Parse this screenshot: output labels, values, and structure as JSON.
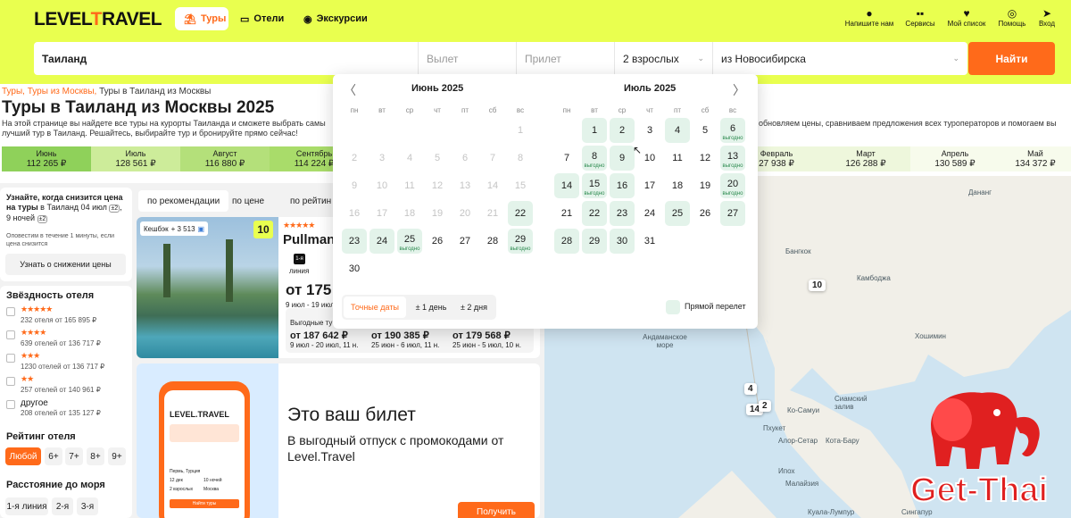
{
  "header": {
    "logo_text": "LEVEL",
    "logo_accent": "T",
    "logo_rest": "RAVEL",
    "nav": [
      {
        "label": "Туры",
        "icon": "palm-icon"
      },
      {
        "label": "Отели",
        "icon": "bed-icon"
      },
      {
        "label": "Экскурсии",
        "icon": "pin-icon"
      }
    ],
    "actions": [
      {
        "label": "Напишите нам",
        "icon": "chat-icon"
      },
      {
        "label": "Сервисы",
        "icon": "grid-icon"
      },
      {
        "label": "Мой список",
        "icon": "heart-icon"
      },
      {
        "label": "Помощь",
        "icon": "lifebuoy-icon"
      },
      {
        "label": "Вход",
        "icon": "login-icon"
      }
    ]
  },
  "search": {
    "destination": "Таиланд",
    "depart_placeholder": "Вылет",
    "arrive_placeholder": "Прилет",
    "guests": "2 взрослых",
    "from_city": "из Новосибирска",
    "submit": "Найти"
  },
  "breadcrumbs": {
    "part1": "Туры,",
    "part2": "Туры из Москвы,",
    "current": "Туры в Таиланд из Москвы"
  },
  "page_title": "Туры в Таиланд из Москвы 2025",
  "description_left": "На этой странице вы найдете все туры на курорты Таиланда и сможете выбрать самы лучший тур в Таиланд. Решайтесь, выбирайте тур и бронируйте прямо сейчас!",
  "description_right": "обновляем цены, сравниваем предложения всех туроператоров и помогаем вы",
  "months": [
    {
      "name": "Июнь",
      "price": "112 265 ₽",
      "color": "#8fd15a"
    },
    {
      "name": "Июль",
      "price": "128 561 ₽",
      "color": "#cdec9a"
    },
    {
      "name": "Август",
      "price": "116 880 ₽",
      "color": "#b4e07a"
    },
    {
      "name": "Сентябрь",
      "price": "114 224 ₽",
      "color": "#a9dc6a"
    },
    {
      "name": "Февраль",
      "price": "27 938 ₽",
      "color": "#eef7dc"
    },
    {
      "name": "Март",
      "price": "126 288 ₽",
      "color": "#eef7dc"
    },
    {
      "name": "Апрель",
      "price": "130 589 ₽",
      "color": "#f7fbec"
    },
    {
      "name": "Май",
      "price": "134 372 ₽",
      "color": "#f7fbec"
    }
  ],
  "sidebar": {
    "notify_title_bold": "Узнайте, когда снизится цена на туры",
    "notify_title_rest": "в Таиланд 04 июл",
    "notify_badge1": "±2",
    "notify_nights": "9 ночей",
    "notify_badge2": "±2",
    "notify_sub": "Оповестим в течение 1 минуты, если цена снизится",
    "notify_button": "Узнать о снижении цены",
    "stars_title": "Звёздность отеля",
    "stars": [
      {
        "stars": "★★★★★",
        "count": "232 отеля от 165 895 ₽"
      },
      {
        "stars": "★★★★",
        "count": "639 отелей от 136 717 ₽"
      },
      {
        "stars": "★★★",
        "count": "1230 отелей от 136 717 ₽"
      },
      {
        "stars": "★★",
        "count": "257 отелей от 140 961 ₽"
      },
      {
        "stars": "другое",
        "count": "208 отелей от 135 127 ₽"
      }
    ],
    "rating_title": "Рейтинг отеля",
    "rating_options": [
      "Любой",
      "6+",
      "7+",
      "8+",
      "9+"
    ],
    "sea_title": "Расстояние до моря",
    "sea_options": [
      "1-я линия",
      "2-я",
      "3-я"
    ]
  },
  "sort_tabs": [
    "по рекомендации",
    "по цене",
    "по рейтин"
  ],
  "hotel_card": {
    "cashback": "Кешбэк",
    "cashback_value": "+ 3 513",
    "rating": "10",
    "stars": "★★★★★",
    "name": "Pullman",
    "line_badge": "1-я",
    "line_label": "линия",
    "price_from": "от 175",
    "dates": "9 июл - 19 июл",
    "best_label": "Выгодные ту",
    "offers": [
      {
        "price": "от 187 642 ₽",
        "dates": "9 июл - 20 июл, 11 н."
      },
      {
        "price": "от 190 385 ₽",
        "dates": "25 июн - 6 июл, 11 н."
      },
      {
        "price": "от 179 568 ₽",
        "dates": "25 июн - 5 июл, 10 н."
      }
    ]
  },
  "promo": {
    "title": "Это ваш билет",
    "subtitle": "В выгодный отпуск с промокодами от Level.Travel",
    "button": "Получить",
    "phone_logo": "LEVEL.TRAVEL",
    "phone_city": "Пермь, Турция",
    "phone_date": "12 дек",
    "phone_nights": "10 ночей",
    "phone_guests": "2 взрослых",
    "phone_from": "Москва",
    "phone_button": "Найти туры"
  },
  "calendar": {
    "month_left": "Июнь 2025",
    "month_right": "Июль 2025",
    "dow": [
      "пн",
      "вт",
      "ср",
      "чт",
      "пт",
      "сб",
      "вс"
    ],
    "badge_text": "выгодно",
    "modes": [
      "Точные даты",
      "± 1 день",
      "± 2 дня"
    ],
    "direct_label": "Прямой перелет"
  },
  "map": {
    "labels": [
      "Дананг",
      "Бангкок",
      "Камбоджа",
      "Андаманское море",
      "Хошимин",
      "Сиамский залив",
      "Пхукет",
      "Малайзия",
      "Куала-Лумпур",
      "Сингапур",
      "Ко-Самуи",
      "Алор-Сетар",
      "Ипох",
      "Кота-Бару"
    ],
    "badges": [
      "10",
      "4",
      "14",
      "2"
    ]
  },
  "watermark": {
    "text": "Get-Thai"
  }
}
